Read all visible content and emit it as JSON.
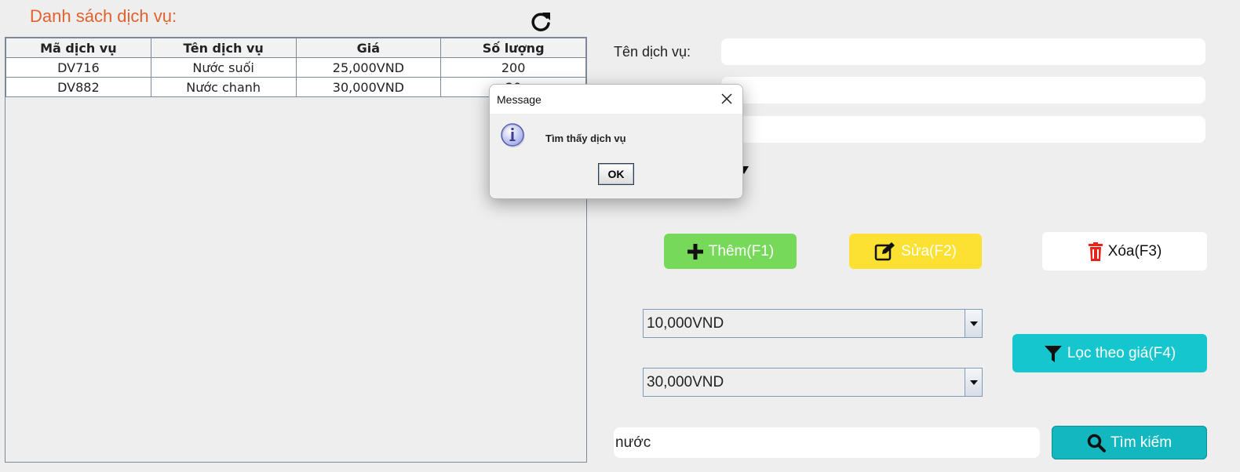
{
  "title": "Danh sách dịch vụ:",
  "table": {
    "columns": [
      "Mã dịch vụ",
      "Tên dịch vụ",
      "Giá",
      "Số lượng"
    ],
    "rows": [
      [
        "DV716",
        "Nước suối",
        "25,000VND",
        "200"
      ],
      [
        "DV882",
        "Nước chanh",
        "30,000VND",
        "20"
      ]
    ]
  },
  "form": {
    "name_label": "Tên dịch vụ:",
    "name_value": "",
    "field2_value": "",
    "field3_value": ""
  },
  "buttons": {
    "add": "Thêm(F1)",
    "edit": "Sửa(F2)",
    "delete": "Xóa(F3)",
    "filter": "Lọc theo giá(F4)",
    "search": "Tìm kiếm"
  },
  "filter": {
    "min_price": "10,000VND",
    "max_price": "30,000VND"
  },
  "search": {
    "value": "nước"
  },
  "dialog": {
    "title": "Message",
    "message": "Tìm thấy dịch vụ",
    "ok_label": "OK"
  },
  "colors": {
    "title": "#e0622e",
    "add_button": "#77d95a",
    "edit_button": "#fce032",
    "delete_button": "#ffffff",
    "filter_button": "#16c6cf",
    "search_button": "#13b7bf"
  }
}
